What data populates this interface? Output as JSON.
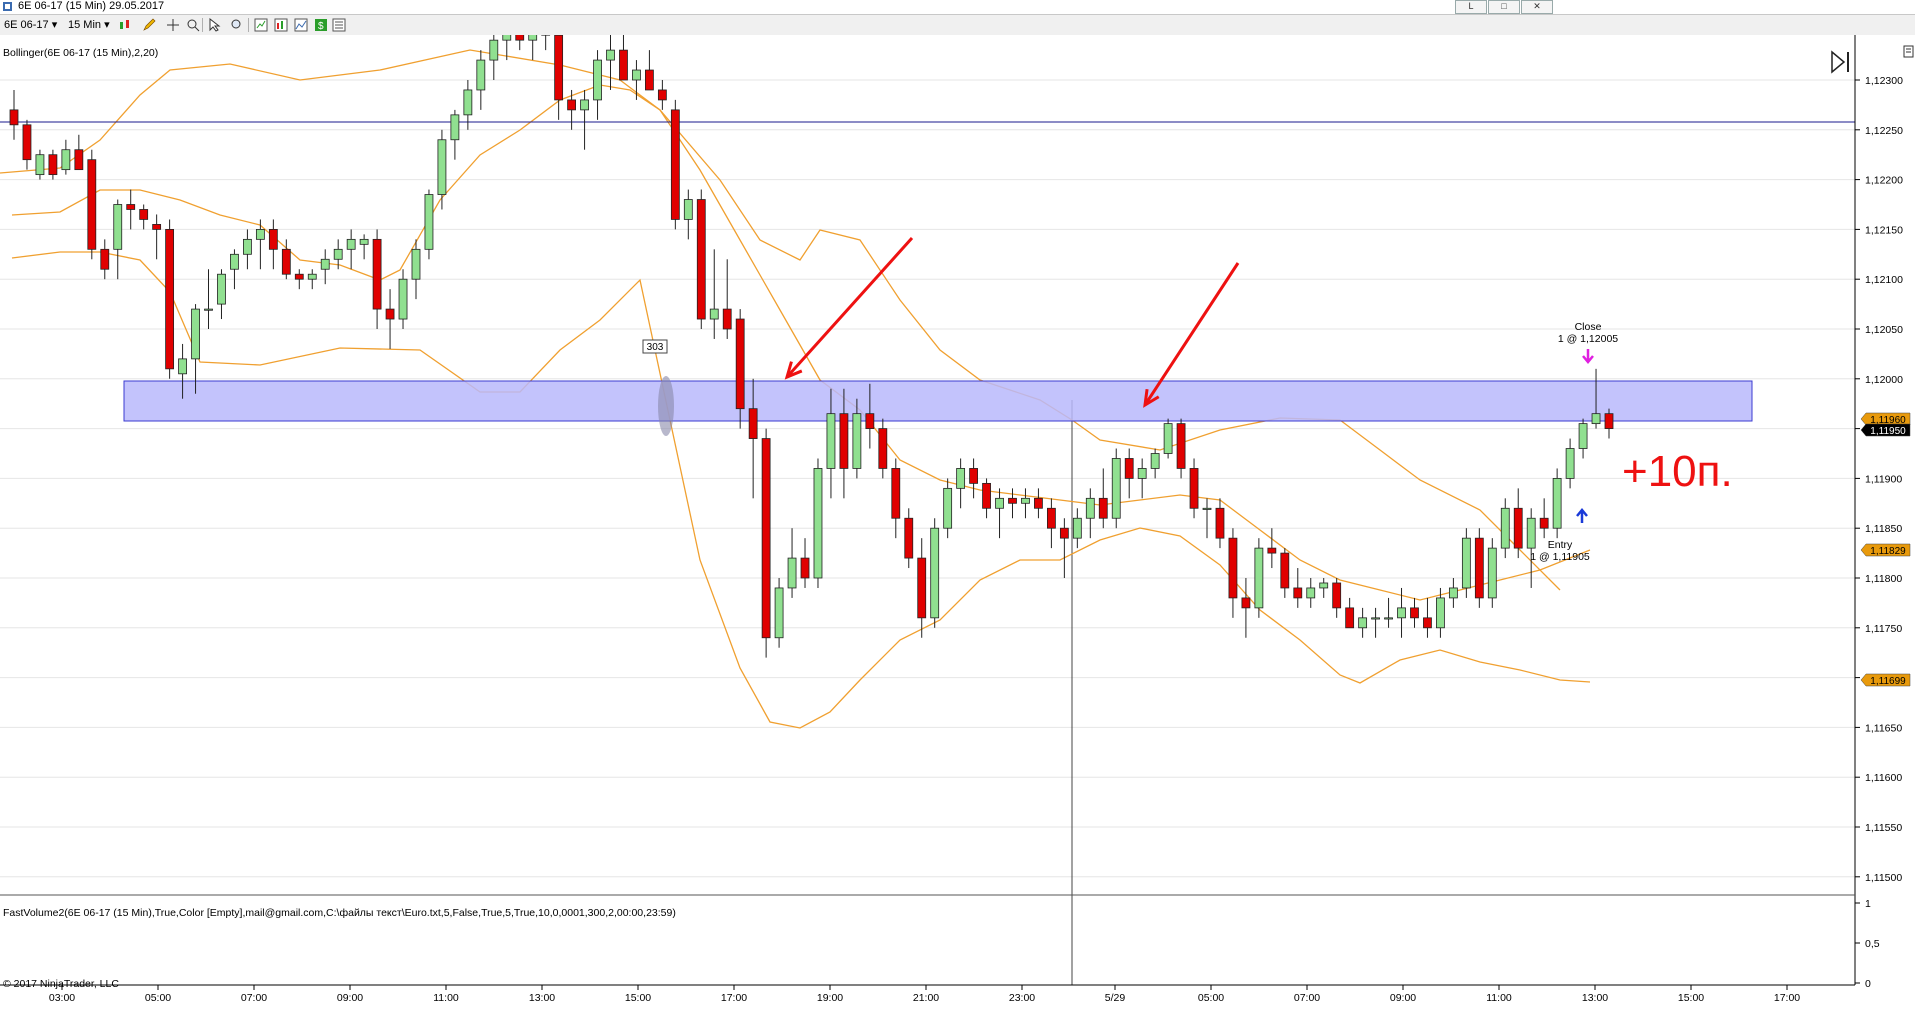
{
  "window": {
    "title": "6E 06-17 (15 Min)  29.05.2017",
    "buttons": [
      "L",
      "□",
      "✕"
    ]
  },
  "toolbar": {
    "instrument": "6E 06-17",
    "interval": "15 Min"
  },
  "indicators": {
    "bollinger_label": "Bollinger(6E 06-17 (15 Min),2,20)",
    "volume_label": "FastVolume2(6E 06-17 (15 Min),True,Color [Empty],mail@gmail.com,C:\\файлы текст\\Euro.txt,5,False,True,5,True,10,0,0001,300,2,00:00,23:59)"
  },
  "copyright": "© 2017 NinjaTrader, LLC",
  "price_axis": {
    "ticks": [
      "1,12300",
      "1,12250",
      "1,12200",
      "1,12150",
      "1,12100",
      "1,12050",
      "1,12000",
      "1,11950",
      "1,11900",
      "1,11850",
      "1,11800",
      "1,11750",
      "1,11700",
      "1,11650",
      "1,11600",
      "1,11550",
      "1,11500"
    ],
    "badges": [
      {
        "text": "1,11960",
        "color": "#e89a0c"
      },
      {
        "text": "1,11950",
        "color": "#000000"
      },
      {
        "text": "1,11829",
        "color": "#e89a0c"
      },
      {
        "text": "1,11699",
        "color": "#e89a0c"
      }
    ]
  },
  "volume_axis": {
    "ticks": [
      "1",
      "0,5",
      "0"
    ]
  },
  "time_axis": {
    "labels": [
      "03:00",
      "05:00",
      "07:00",
      "09:00",
      "11:00",
      "13:00",
      "15:00",
      "17:00",
      "19:00",
      "21:00",
      "23:00",
      "5/29",
      "05:00",
      "07:00",
      "09:00",
      "11:00",
      "13:00",
      "15:00",
      "17:00"
    ]
  },
  "annotations": {
    "close_label": "Close",
    "close_price": "1 @ 1,12005",
    "entry_label": "Entry",
    "entry_price": "1 @ 1,11905",
    "marker_303": "303",
    "handwritten": "+10п."
  },
  "chart_data": {
    "type": "candlestick",
    "instrument": "6E 06-17",
    "interval": "15 Min",
    "date": "29.05.2017",
    "zone": {
      "low": 1.1196,
      "high": 1.12
    },
    "horizontal_line": 1.12258
  }
}
